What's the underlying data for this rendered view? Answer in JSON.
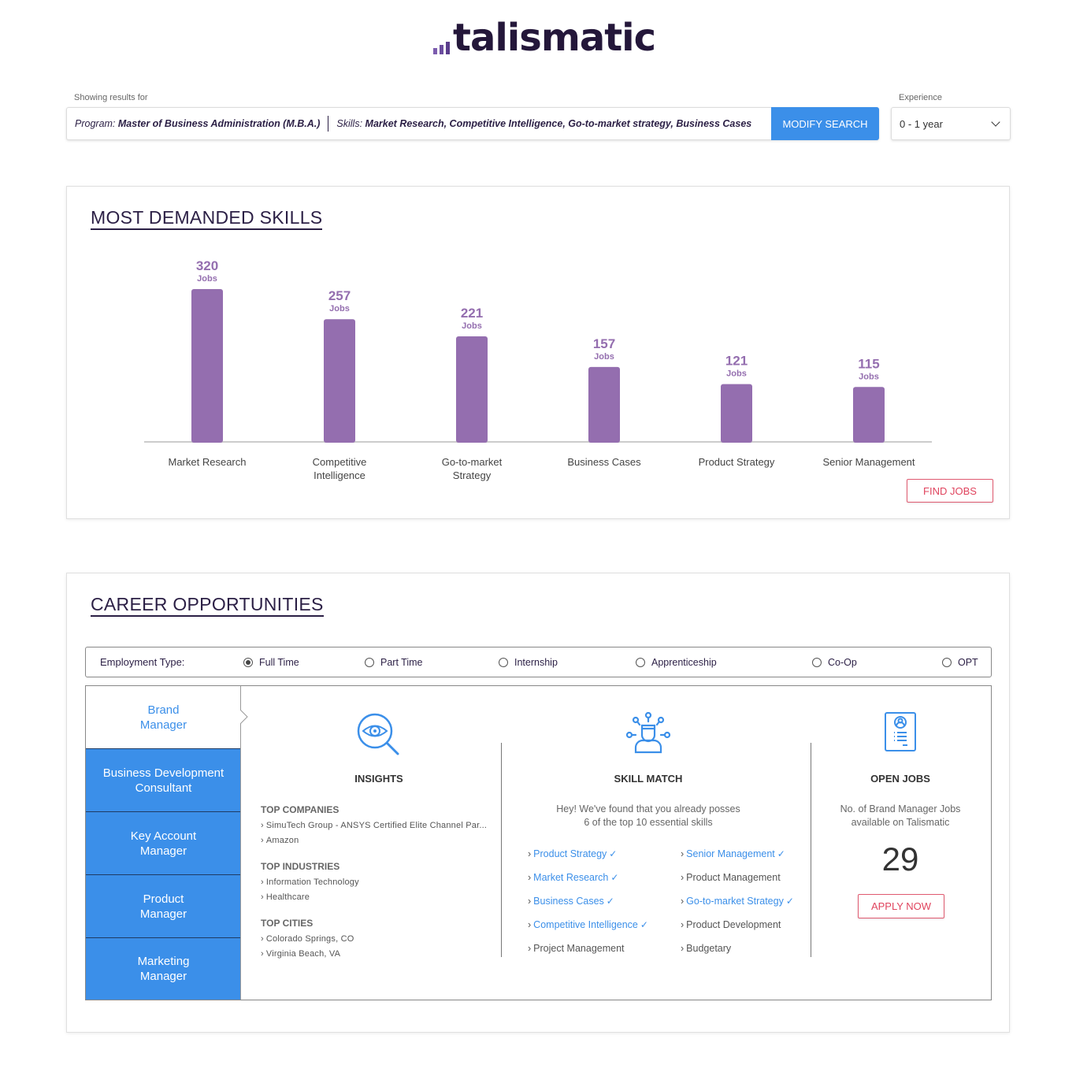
{
  "brand": {
    "name": "talismatic"
  },
  "search": {
    "showing_label": "Showing results for",
    "program_label": "Program:",
    "program_value": "Master of Business Administration (M.B.A.)",
    "skills_label": "Skills:",
    "skills_value": "Market Research, Competitive Intelligence, Go-to-market strategy, Business Cases",
    "modify_button": "MODIFY SEARCH",
    "experience_label": "Experience",
    "experience_value": "0 - 1 year"
  },
  "skills_section": {
    "title": "MOST DEMANDED SKILLS",
    "find_jobs_button": "FIND JOBS"
  },
  "chart_data": {
    "type": "bar",
    "title": "MOST DEMANDED SKILLS",
    "categories": [
      "Market Research",
      "Competitive Intelligence",
      "Go-to-market Strategy",
      "Business Cases",
      "Product Strategy",
      "Senior Management"
    ],
    "category_lines": [
      [
        "Market Research"
      ],
      [
        "Competitive",
        "Intelligence"
      ],
      [
        "Go-to-market",
        "Strategy"
      ],
      [
        "Business Cases"
      ],
      [
        "Product Strategy"
      ],
      [
        "Senior Management"
      ]
    ],
    "values": [
      320,
      257,
      221,
      157,
      121,
      115
    ],
    "value_unit": "Jobs",
    "xlabel": "",
    "ylabel": "",
    "grid": false,
    "bar_color": "#946eaf",
    "label_color": "#946eaf"
  },
  "career_section": {
    "title": "CAREER OPPORTUNITIES",
    "employment_type_label": "Employment Type:",
    "employment_types": [
      {
        "label": "Full Time",
        "selected": true
      },
      {
        "label": "Part Time",
        "selected": false
      },
      {
        "label": "Internship",
        "selected": false
      },
      {
        "label": "Apprenticeship",
        "selected": false
      },
      {
        "label": "Co-Op",
        "selected": false
      },
      {
        "label": "OPT",
        "selected": false
      }
    ],
    "roles": [
      {
        "label": "Brand Manager",
        "lines": [
          "Brand",
          "Manager"
        ],
        "active": true
      },
      {
        "label": "Business Development Consultant",
        "lines": [
          "Business Development",
          "Consultant"
        ],
        "active": false
      },
      {
        "label": "Key Account Manager",
        "lines": [
          "Key Account",
          "Manager"
        ],
        "active": false
      },
      {
        "label": "Product Manager",
        "lines": [
          "Product",
          "Manager"
        ],
        "active": false
      },
      {
        "label": "Marketing Manager",
        "lines": [
          "Marketing",
          "Manager"
        ],
        "active": false
      }
    ],
    "insights": {
      "title": "INSIGHTS",
      "icon": "eye-search-icon",
      "groups": [
        {
          "heading": "TOP COMPANIES",
          "items": [
            "SimuTech Group - ANSYS Certified Elite Channel Par...",
            "Amazon"
          ]
        },
        {
          "heading": "TOP INDUSTRIES",
          "items": [
            "Information Technology",
            "Healthcare"
          ]
        },
        {
          "heading": "TOP CITIES",
          "items": [
            "Colorado Springs, CO",
            "Virginia Beach, VA"
          ]
        }
      ]
    },
    "skill_match": {
      "title": "SKILL MATCH",
      "icon": "person-network-icon",
      "description_line1": "Hey! We've found that you already posses",
      "description_line2": "6 of the top 10 essential skills",
      "skills": [
        {
          "label": "Product Strategy",
          "matched": true
        },
        {
          "label": "Senior Management",
          "matched": true
        },
        {
          "label": "Market Research",
          "matched": true
        },
        {
          "label": "Product Management",
          "matched": false
        },
        {
          "label": "Business Cases",
          "matched": true
        },
        {
          "label": "Go-to-market Strategy",
          "matched": true
        },
        {
          "label": "Competitive Intelligence",
          "matched": true
        },
        {
          "label": "Product Development",
          "matched": false
        },
        {
          "label": "Project Management",
          "matched": false
        },
        {
          "label": "Budgetary",
          "matched": false
        }
      ]
    },
    "open_jobs": {
      "title": "OPEN JOBS",
      "icon": "resume-icon",
      "description_line1": "No. of Brand Manager Jobs",
      "description_line2": "available on Talismatic",
      "count": "29",
      "apply_button": "APPLY NOW"
    }
  },
  "colors": {
    "accent_blue": "#3b8fe9",
    "brand_dark": "#2b1f45",
    "bar_purple": "#946eaf",
    "cta_red": "#e0445e"
  }
}
